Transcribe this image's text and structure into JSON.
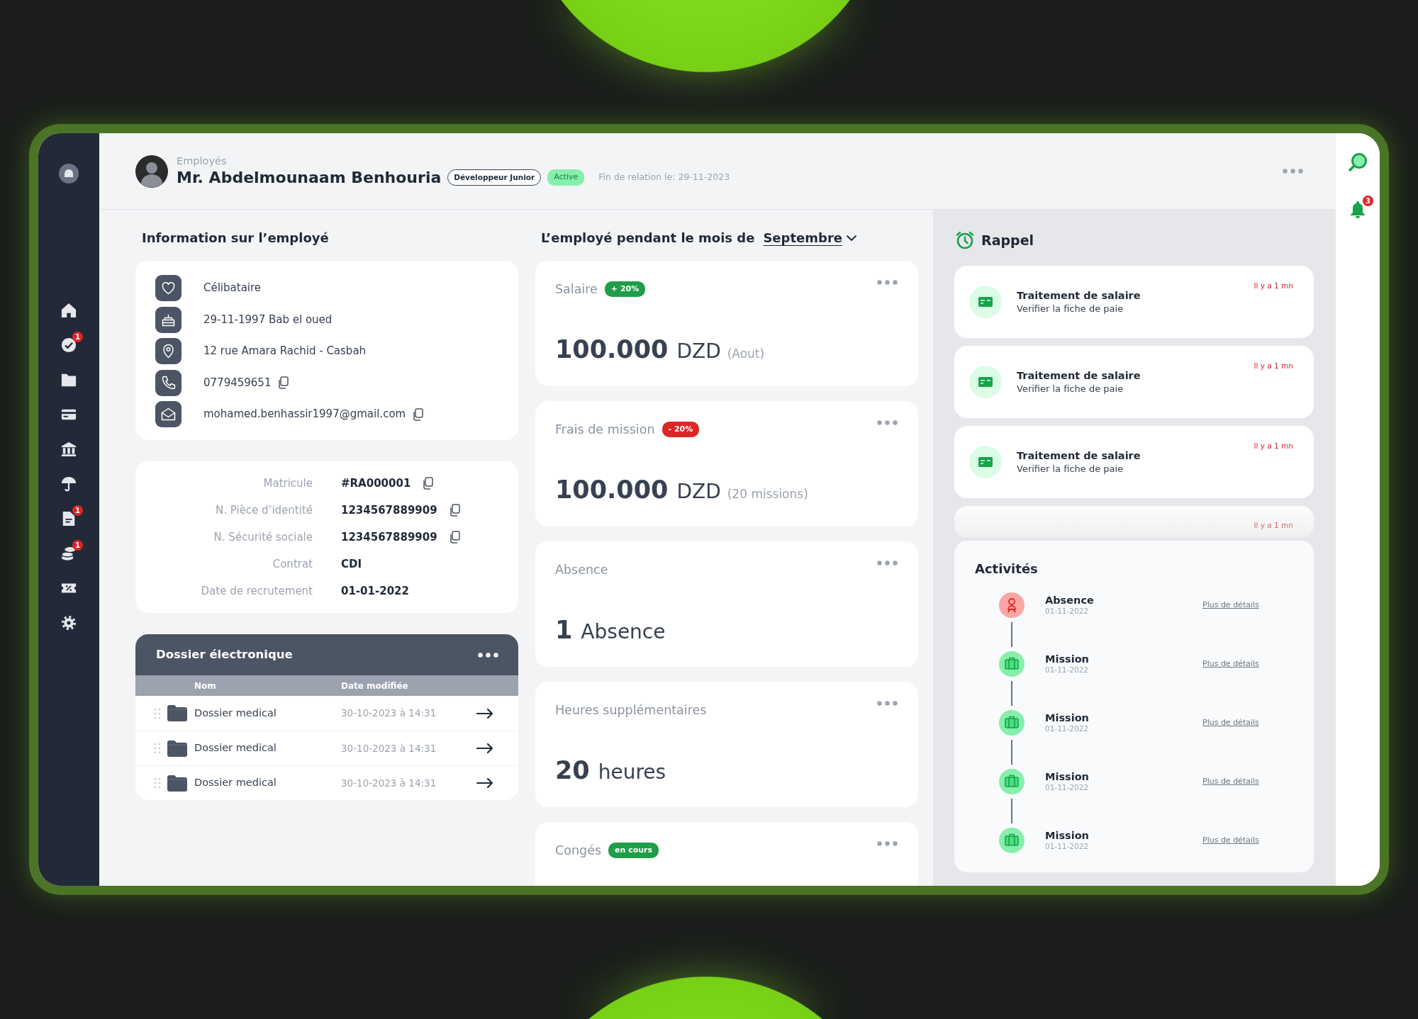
{
  "sidebar": {
    "items": [
      {
        "kind": "home"
      },
      {
        "kind": "tasks",
        "badge": "1"
      },
      {
        "kind": "files"
      },
      {
        "kind": "cards"
      },
      {
        "kind": "bank"
      },
      {
        "kind": "insurance"
      },
      {
        "kind": "documents",
        "badge": "1"
      },
      {
        "kind": "payments",
        "badge": "1"
      },
      {
        "kind": "coupons"
      },
      {
        "kind": "settings"
      }
    ]
  },
  "header": {
    "breadcrumb": "Employés",
    "name": "Mr. Abdelmounaam Benhouria",
    "role": "Développeur Junior",
    "status": "Active",
    "end_date": "Fin de relation le: 29-11-2023"
  },
  "toolbar": {
    "notification_count": "3"
  },
  "employee_info": {
    "title": "Information sur l’employé",
    "contacts": [
      {
        "kind": "status",
        "text": "Célibataire",
        "copyable": false
      },
      {
        "kind": "birth",
        "text": "29-11-1997 Bab el oued",
        "copyable": false
      },
      {
        "kind": "address",
        "text": "12 rue Amara Rachid - Casbah",
        "copyable": false
      },
      {
        "kind": "phone",
        "text": "0779459651",
        "copyable": true
      },
      {
        "kind": "email",
        "text": "mohamed.benhassir1997@gmail.com",
        "copyable": true
      }
    ],
    "details": [
      {
        "label": "Matricule",
        "value": "#RA000001",
        "copyable": true
      },
      {
        "label": "N. Pièce d’identité",
        "value": "1234567889909",
        "copyable": true
      },
      {
        "label": "N. Sécurité sociale",
        "value": "1234567889909",
        "copyable": true
      },
      {
        "label": "Contrat",
        "value": "CDI",
        "copyable": false
      },
      {
        "label": "Date de recrutement",
        "value": "01-01-2022",
        "copyable": false
      }
    ]
  },
  "dossier": {
    "title": "Dossier électronique",
    "columns": [
      "Nom",
      "Date modifiée"
    ],
    "rows": [
      {
        "name": "Dossier medical",
        "date": "30-10-2023 à 14:31"
      },
      {
        "name": "Dossier medical",
        "date": "30-10-2023 à 14:31"
      },
      {
        "name": "Dossier medical",
        "date": "30-10-2023 à 14:31"
      }
    ]
  },
  "month": {
    "title": "L’employé pendant le mois de",
    "month": "Septembre",
    "cards": [
      {
        "title": "Salaire",
        "badge": {
          "text": "+ 20%",
          "color": "#1f9d48"
        },
        "amount": "100.000",
        "unit": "DZD",
        "note": "(Aout)"
      },
      {
        "title": "Frais de mission",
        "badge": {
          "text": "- 20%",
          "color": "#dc2626"
        },
        "amount": "100.000",
        "unit": "DZD",
        "note": "(20 missions)"
      },
      {
        "title": "Absence",
        "amount": "1",
        "unit": "Absence"
      },
      {
        "title": "Heures supplémentaires",
        "amount": "20",
        "unit": "heures"
      },
      {
        "title": "Congés",
        "badge": {
          "text": "en cours",
          "color": "#1f9d48"
        }
      }
    ]
  },
  "reminders": {
    "title": "Rappel",
    "items": [
      {
        "title": "Traitement de salaire",
        "subtitle": "Verifier la fiche de paie",
        "time": "Il y a 1 mn",
        "faded": false
      },
      {
        "title": "Traitement de salaire",
        "subtitle": "Verifier la fiche de paie",
        "time": "Il y a 1 mn",
        "faded": false
      },
      {
        "title": "Traitement de salaire",
        "subtitle": "Verifier la fiche de paie",
        "time": "Il y a 1 mn",
        "faded": false
      },
      {
        "time": "Il y a 1 mn",
        "faded": true
      }
    ]
  },
  "activities": {
    "title": "Activités",
    "items": [
      {
        "kind": "absence",
        "title": "Absence",
        "date": "01-11-2022",
        "link": "Plus de détails"
      },
      {
        "kind": "mission",
        "title": "Mission",
        "date": "01-11-2022",
        "link": "Plus de détails"
      },
      {
        "kind": "mission",
        "title": "Mission",
        "date": "01-11-2022",
        "link": "Plus de détails"
      },
      {
        "kind": "mission",
        "title": "Mission",
        "date": "01-11-2022",
        "link": "Plus de détails"
      },
      {
        "kind": "mission",
        "title": "Mission",
        "date": "01-11-2022",
        "link": "Plus de détails"
      }
    ]
  }
}
